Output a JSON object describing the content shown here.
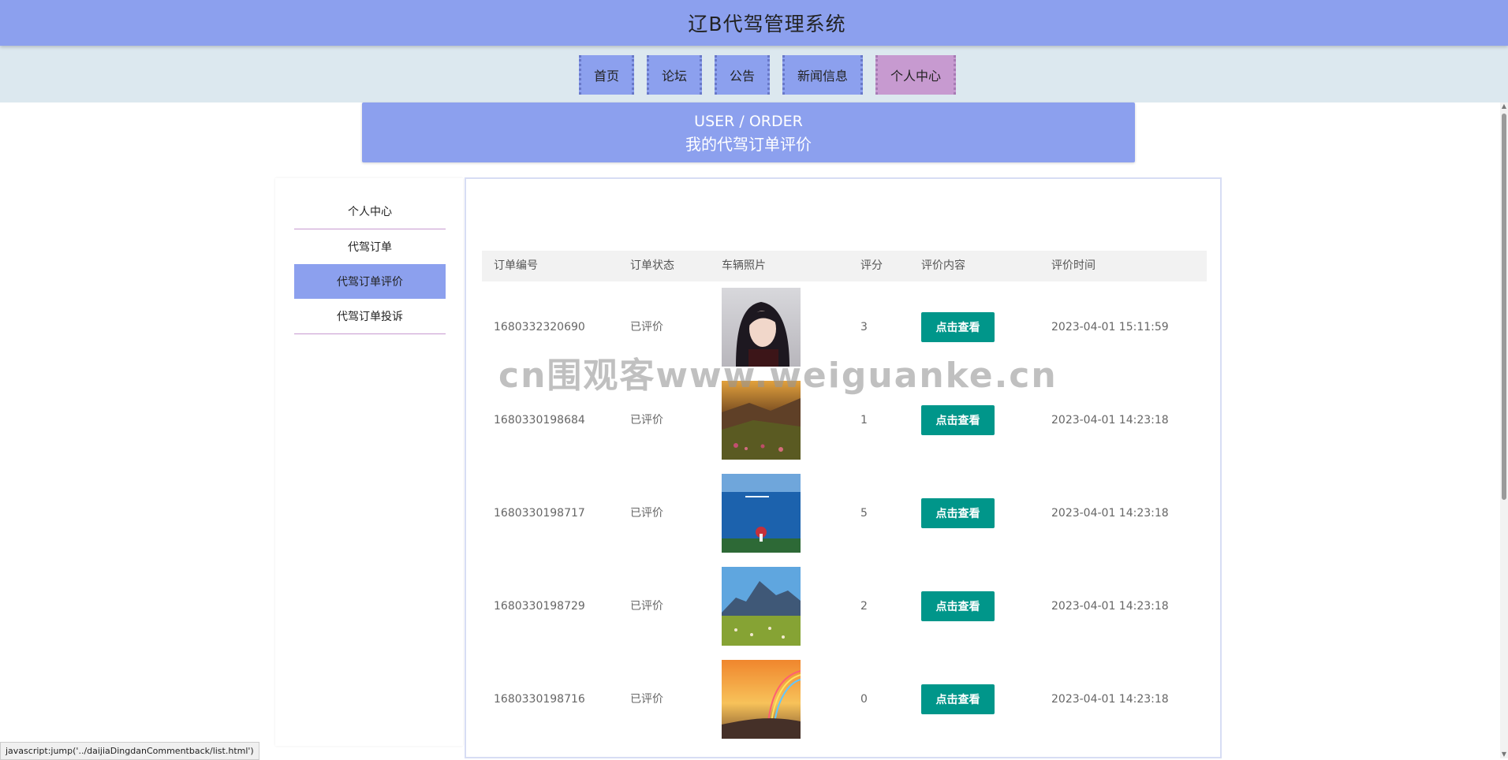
{
  "app": {
    "title": "辽B代驾管理系统"
  },
  "nav": {
    "items": [
      {
        "label": "首页"
      },
      {
        "label": "论坛"
      },
      {
        "label": "公告"
      },
      {
        "label": "新闻信息"
      },
      {
        "label": "个人中心",
        "active": true
      }
    ]
  },
  "banner": {
    "en": "USER / ORDER",
    "cn": "我的代驾订单评价"
  },
  "sidebar": {
    "items": [
      {
        "label": "个人中心"
      },
      {
        "label": "代驾订单"
      },
      {
        "label": "代驾订单评价",
        "active": true
      },
      {
        "label": "代驾订单投诉"
      }
    ]
  },
  "table": {
    "headers": [
      "订单编号",
      "订单状态",
      "车辆照片",
      "评分",
      "评价内容",
      "评价时间"
    ],
    "rows": [
      {
        "order_no": "1680332320690",
        "status": "已评价",
        "photo": "portrait-photo",
        "score": "3",
        "action": "点击查看",
        "time": "2023-04-01 15:11:59"
      },
      {
        "order_no": "1680330198684",
        "status": "已评价",
        "photo": "sunset-meadow-photo",
        "score": "1",
        "action": "点击查看",
        "time": "2023-04-01 14:23:18"
      },
      {
        "order_no": "1680330198717",
        "status": "已评价",
        "photo": "blue-sea-photo",
        "score": "5",
        "action": "点击查看",
        "time": "2023-04-01 14:23:18"
      },
      {
        "order_no": "1680330198729",
        "status": "已评价",
        "photo": "mountain-field-photo",
        "score": "2",
        "action": "点击查看",
        "time": "2023-04-01 14:23:18"
      },
      {
        "order_no": "1680330198716",
        "status": "已评价",
        "photo": "rainbow-coast-photo",
        "score": "0",
        "action": "点击查看",
        "time": "2023-04-01 14:23:18"
      }
    ]
  },
  "watermark": "cn围观客www.weiguanke.cn",
  "status_bar": "javascript:jump('../daijiaDingdanCommentback/list.html')",
  "colors": {
    "primary": "#8ca0ee",
    "active_nav": "#c79ad0",
    "button": "#00968a"
  }
}
